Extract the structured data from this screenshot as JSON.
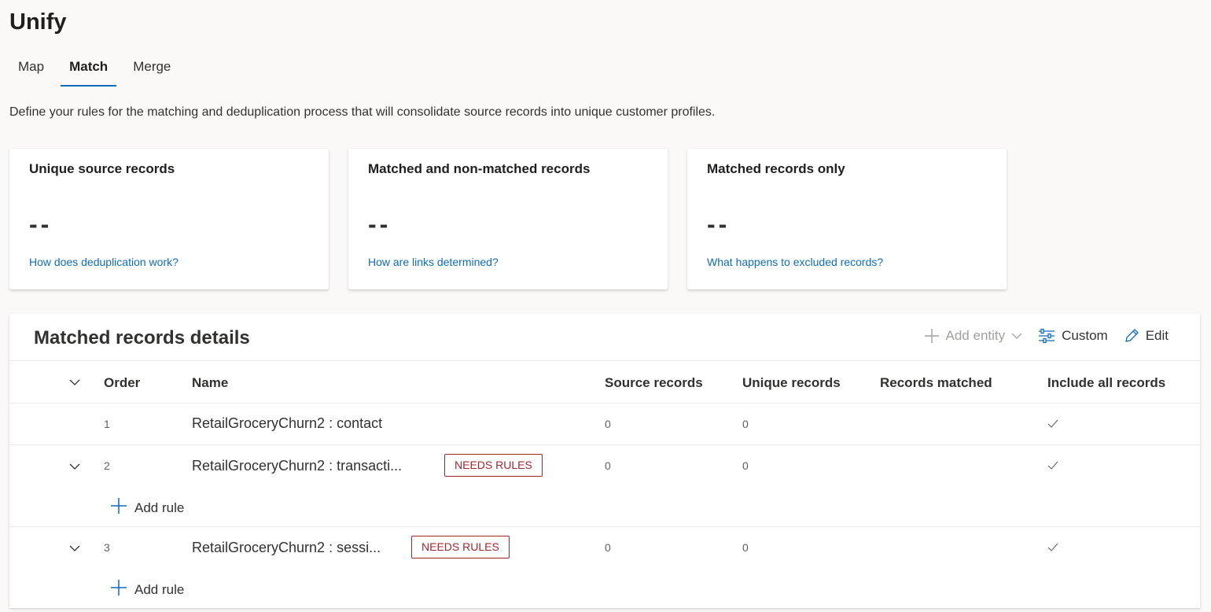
{
  "page": {
    "title": "Unify",
    "description": "Define your rules for the matching and deduplication process that will consolidate source records into unique customer profiles."
  },
  "tabs": [
    {
      "label": "Map",
      "active": false
    },
    {
      "label": "Match",
      "active": true
    },
    {
      "label": "Merge",
      "active": false
    }
  ],
  "cards": [
    {
      "title": "Unique source records",
      "value": "--",
      "link": "How does deduplication work?"
    },
    {
      "title": "Matched and non-matched records",
      "value": "--",
      "link": "How are links determined?"
    },
    {
      "title": "Matched records only",
      "value": "--",
      "link": "What happens to excluded records?"
    }
  ],
  "panel": {
    "title": "Matched records details",
    "toolbar": {
      "add_entity": "Add entity",
      "custom": "Custom",
      "edit": "Edit"
    },
    "columns": {
      "order": "Order",
      "name": "Name",
      "source": "Source records",
      "unique": "Unique records",
      "matched": "Records matched",
      "include": "Include all records"
    },
    "rows": [
      {
        "order": "1",
        "name": "RetailGroceryChurn2 : contact",
        "badge": "",
        "source": "0",
        "unique": "0",
        "matched": "",
        "include": true
      },
      {
        "order": "2",
        "name": "RetailGroceryChurn2 : transacti...",
        "badge": "NEEDS RULES",
        "source": "0",
        "unique": "0",
        "matched": "",
        "include": true,
        "add_rule": "Add rule"
      },
      {
        "order": "3",
        "name": "RetailGroceryChurn2 : sessi...",
        "badge": "NEEDS RULES",
        "source": "0",
        "unique": "0",
        "matched": "",
        "include": true,
        "add_rule": "Add rule"
      }
    ]
  },
  "colors": {
    "accent": "#0f6cbd",
    "warning": "#a4262c",
    "background": "#faf9f8"
  }
}
